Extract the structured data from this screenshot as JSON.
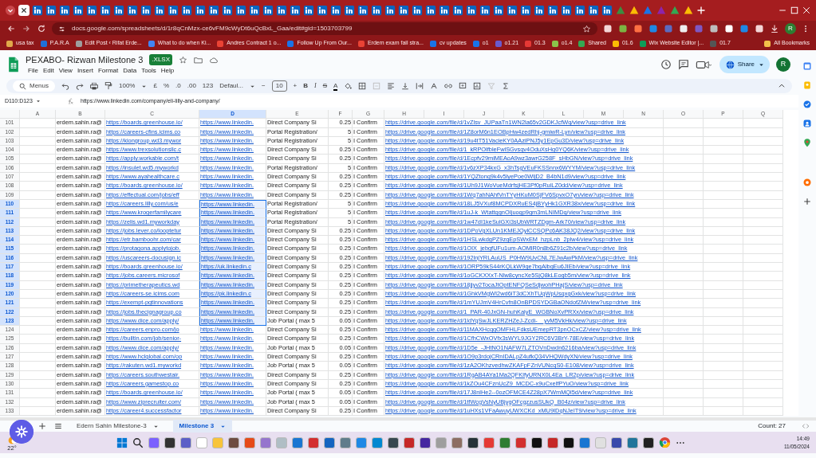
{
  "browser": {
    "url": "docs.google.com/spreadsheets/d/1r8qCnMzx-ce6vFM9cWyDt6uQcBxL_Gaa/edit#gid=1503703799",
    "profile": "R",
    "all_bookmarks": "All Bookmarks",
    "bookmarks": [
      "usa tax",
      "P.A.R.A",
      "Edit Post ‹ Rifat Erde...",
      "What to do when Ki...",
      "Andres Contract 1 o...",
      "Follow Up From Our...",
      "Erdem exam fail stra...",
      "cv updates",
      "o1",
      "o1.21",
      "01.3",
      "o1.4",
      "Shared",
      "01.6",
      "Wix Website Editor |...",
      "01.7"
    ]
  },
  "doc": {
    "title": "PEXABO- Rizwan Milestone 3",
    "badge": ".XLSX",
    "menu": [
      "File",
      "Edit",
      "View",
      "Insert",
      "Format",
      "Data",
      "Tools",
      "Help"
    ],
    "share": "Share",
    "avatar": "R"
  },
  "toolbar": {
    "search": "Menus",
    "zoom": "100%",
    "currency": "£",
    "percent": "%",
    "decrease_decimal": ".0",
    "increase_decimal": ".00",
    "number_format": "123",
    "font": "Defaul...",
    "font_size": "10",
    "minus": "−",
    "plus": "+",
    "bold": "B",
    "italic": "I",
    "strike": "S",
    "text_color": "A"
  },
  "formula_bar": {
    "name_box": "D110:D123",
    "formula": "https://www.linkedin.com/company/eli-lilly-and-company/"
  },
  "columns": [
    {
      "label": "A",
      "selected": false
    },
    {
      "label": "B",
      "kind": "text",
      "selected": false
    },
    {
      "label": "C",
      "kind": "link",
      "selected": false
    },
    {
      "label": "D",
      "kind": "link",
      "selected": true
    },
    {
      "label": "E",
      "kind": "text",
      "selected": false
    },
    {
      "label": "F",
      "kind": "number",
      "selected": false
    },
    {
      "label": "G",
      "kind": "text",
      "selected": false
    },
    {
      "label": "H",
      "kind": "link",
      "selected": false
    },
    {
      "label": "I",
      "selected": false
    },
    {
      "label": "J",
      "selected": false
    },
    {
      "label": "K",
      "selected": false
    },
    {
      "label": "L",
      "selected": false
    },
    {
      "label": "M",
      "selected": false
    },
    {
      "label": "N",
      "selected": false
    },
    {
      "label": "O",
      "selected": false
    },
    {
      "label": "P",
      "selected": false
    },
    {
      "label": "Q",
      "selected": false
    }
  ],
  "rows": [
    {
      "number": "101",
      "selected": false,
      "cells": [
        "erdem.sahin.ra@",
        "https://boards.greenhouse.io/",
        "https://www.linkedin.",
        "Direct Company Si",
        "0.25",
        "I Confirm",
        "https://drive.google.com/file/d/1vZlsv_JUPaaTn1WN2la65v2GDKJcfWq/view?usp=drive_link"
      ]
    },
    {
      "number": "102",
      "selected": false,
      "cells": [
        "erdem.sahin.ra@",
        "https://careers-cfins.icims.co",
        "https://www.linkedin.",
        "Portal Registration/",
        "5",
        "I Confirm",
        "https://drive.google.com/file/d/1Z8orM6n1EOBpHw4zedRhj-gmiwR-Lyn/view?usp=drive_link"
      ]
    },
    {
      "number": "103",
      "selected": false,
      "cells": [
        "erdem.sahin.ra@",
        "https://kiongroup.wd3.mywor",
        "https://www.linkedin.",
        "Portal Registration/",
        "5",
        "I Confirm",
        "https://drive.google.com/file/d/19u4tT51VacieKY0AAziPNJ5y1EpGu3D/view?usp=drive_link"
      ]
    },
    {
      "number": "104",
      "selected": false,
      "cells": [
        "erdem.sahin.ra@",
        "https://www.trexsolutionsllc.c",
        "https://www.linkedin.",
        "Direct Company Si",
        "0.25",
        "I Confirm",
        "https://drive.google.com/file/d/1_kRPOlfbleFwlSGvsqv4OduXsHg0YQ6K/view?usp=drive_link"
      ]
    },
    {
      "number": "105",
      "selected": false,
      "cells": [
        "erdem.sahin.ra@",
        "https://apply.workable.com/t",
        "https://www.linkedin.",
        "Direct Company Si",
        "0.25",
        "I Confirm",
        "https://drive.google.com/file/d/1Ecpfv29miMEAoA9wz3awrG258F_sHbGN/view?usp=drive_link"
      ]
    },
    {
      "number": "106",
      "selected": false,
      "cells": [
        "erdem.sahin.ra@",
        "https://insulet.wd5.myworkd",
        "https://www.linkedin.",
        "Portal Registration/",
        "5",
        "I Confirm",
        "https://drive.google.com/file/d/1v6zXP34kxG_x3hTsgVEuFKSSnnx6WYYM/view?usp=drive_link"
      ]
    },
    {
      "number": "107",
      "selected": false,
      "cells": [
        "erdem.sahin.ra@",
        "https://www.ayahealthcare.c",
        "https://www.linkedin.",
        "Direct Company Si",
        "0.25",
        "I Confirm",
        "https://drive.google.com/file/d/1YQZtonq9k4v5lyePoe0WljD2_B4bN1d9/view?usp=drive_link"
      ]
    },
    {
      "number": "108",
      "selected": false,
      "cells": [
        "erdem.sahin.ra@",
        "https://boards.greenhouse.io/",
        "https://www.linkedin.",
        "Direct Company Si",
        "0.25",
        "I Confirm",
        "https://drive.google.com/file/d/1Uh9J1WoVueMdrfsjHE3Pf0pRuiLZ0dd/view?usp=drive_link"
      ]
    },
    {
      "number": "109",
      "selected": false,
      "cells": [
        "erdem.sahin.ra@",
        "https://effectual.com/jobs/eff",
        "https://www.linkedin.",
        "Direct Company Si",
        "0.25",
        "I Confirm",
        "https://drive.google.com/file/d/1Wq7ahNAhfVnTYyHKuM0SjFV6SpvxO7yn/view?usp=drive_link"
      ]
    },
    {
      "number": "110",
      "selected": true,
      "cells": [
        "erdem.sahin.ra@",
        "https://careers.lilly.com/us/e",
        "https://www.linkedin.",
        "Portal Registration/",
        "5",
        "I Confirm",
        "https://drive.google.com/file/d/18LJ5VXuf8MCPDXRuES4jBYyHk1GXR38x/view?usp=drive_link"
      ]
    },
    {
      "number": "111",
      "selected": true,
      "cells": [
        "erdem.sahin.ra@",
        "https://www.krogerfamilycare",
        "https://www.linkedin.",
        "Portal Registration/",
        "5",
        "I Confirm",
        "https://drive.google.com/file/d/1uJ-k_WtattqgnOIjuoqp9gm3mLNIMDq/view?usp=drive_link"
      ]
    },
    {
      "number": "112",
      "selected": true,
      "cells": [
        "erdem.sahin.ra@",
        "https://zelis.wd1.myworkday",
        "https://www.linkedin.",
        "Portal Registration/",
        "5",
        "I Confirm",
        "https://drive.google.com/file/d/1w47dI1keSulGXi3sUbWRTZDgm-Ark70/view?usp=drive_link"
      ]
    },
    {
      "number": "113",
      "selected": true,
      "cells": [
        "erdem.sahin.ra@",
        "https://jobs.lever.co/looptetur",
        "https://www.linkedin.",
        "Direct Company Si",
        "0.25",
        "I Confirm",
        "https://drive.google.com/file/d/1DPoVgXLUn1KMEJQylCCSQPc6AK38JQ2/view?usp=drive_link"
      ]
    },
    {
      "number": "114",
      "selected": true,
      "cells": [
        "erdem.sahin.ra@",
        "https://etr.bamboohr.com/car",
        "https://www.linkedin.",
        "Direct Company Si",
        "0.25",
        "I Confirm",
        "https://drive.google.com/file/d/1HSLwkdgPZ9zgEpSWxEM_hzpLnb_2plw4/view?usp=drive_link"
      ]
    },
    {
      "number": "115",
      "selected": true,
      "cells": [
        "erdem.sahin.ra@",
        "https://protagona.applytojob.",
        "https://www.linkedin.",
        "Direct Company Si",
        "0.25",
        "I Confirm",
        "https://drive.google.com/file/d/1OIX_jebgfUFu1um-AOMlR0n8b6Z91c2b/view?usp=drive_link"
      ]
    },
    {
      "number": "116",
      "selected": true,
      "cells": [
        "erdem.sahin.ra@",
        "https://uscareers-docusign.ic",
        "https://www.linkedin.",
        "Direct Company Si",
        "0.25",
        "I Confirm",
        "https://drive.google.com/file/d/192lnjYRLAuUS_P0HW9UvCNL7EJwAwPkM/view?usp=drive_link"
      ]
    },
    {
      "number": "117",
      "selected": true,
      "cells": [
        "erdem.sahin.ra@",
        "https://boards.greenhouse.io/",
        "https://uk.linkedin.c",
        "Direct Company Si",
        "0.25",
        "I Confirm",
        "https://drive.google.com/file/d/1ORP59kS44rKQLkW9ge7bgAlbgEu6JIEb/view?usp=drive_link"
      ]
    },
    {
      "number": "118",
      "selected": true,
      "cells": [
        "erdem.sahin.ra@",
        "https://jobs.careers.microsof",
        "https://www.linkedin.",
        "Direct Company Si",
        "0.25",
        "I Confirm",
        "https://drive.google.com/file/d/1oGCKXXxT-Nlw8cyncXe5SjQ8kLEogb5m/view?usp=drive_link"
      ]
    },
    {
      "number": "119",
      "selected": true,
      "cells": [
        "erdem.sahin.ra@",
        "https://primetherapeutics.wd",
        "https://www.linkedin.",
        "Direct Company Si",
        "0.25",
        "I Confirm",
        "https://drive.google.com/file/d/18jjyv2TocaJtOptENFQSeSdjwohPHajS/view?usp=drive_link"
      ]
    },
    {
      "number": "120",
      "selected": true,
      "cells": [
        "erdem.sahin.ra@",
        "https://careers-se.icims.com",
        "https://pk.linkedin.c",
        "Direct Company Si",
        "0.25",
        "I Confirm",
        "https://drive.google.com/file/d/1GhkVMgWI2wd6iT3dCXhTUqWpUsqxgGxk/view?usp=drive_link"
      ]
    },
    {
      "number": "121",
      "selected": true,
      "cells": [
        "erdem.sahin.ra@",
        "https://exempt-pgtinnovations",
        "https://www.linkedin.",
        "Direct Company Si",
        "0.25",
        "I Confirm",
        "https://drive.google.com/file/d/1mYUJmV4HrCvfn8OnBPDSYDGBaONdofZM/view?usp=drive_link"
      ]
    },
    {
      "number": "122",
      "selected": true,
      "cells": [
        "erdem.sahin.ra@",
        "https://jobs.thecignagroup.co",
        "https://www.linkedin.",
        "Direct Company Si",
        "0.25",
        "I Confirm",
        "https://drive.google.com/file/d/1_PAR-40JxGN-huhKalyE_WGBNoXvPRXx/view?usp=drive_link"
      ]
    },
    {
      "number": "123",
      "selected": true,
      "cells": [
        "erdem.sahin.ra@",
        "https://www.dice.com/apply/",
        "https://www.linkedin.",
        "Job Portal ( max 5",
        "0.05",
        "I Confirm",
        "https://drive.google.com/file/d/1ldYqSwJLKERZHZeJ-Zcdi-__yvM5VkHk/view?usp=drive_link"
      ]
    },
    {
      "number": "124",
      "selected": false,
      "cells": [
        "erdem.sahin.ra@",
        "https://careers.enpro.com/jo",
        "https://www.linkedin.",
        "Direct Company Si",
        "0.25",
        "I Confirm",
        "https://drive.google.com/file/d/11MAXHcqgOMFHLFdksUEmepRT3pnOCxCZ/view?usp=drive_link"
      ]
    },
    {
      "number": "125",
      "selected": false,
      "cells": [
        "erdem.sahin.ra@",
        "https://builtin.com/job/senior-",
        "https://www.linkedin.",
        "Direct Company Si",
        "0.25",
        "I Confirm",
        "https://drive.google.com/file/d/1CfhCWxOVfx3sWYL9JGY2RC6V3BrY-78E/view?usp=drive_link"
      ]
    },
    {
      "number": "126",
      "selected": false,
      "cells": [
        "erdem.sahin.ra@",
        "https://www.dice.com/apply/",
        "https://www.linkedin.",
        "Job Portal ( max 5",
        "0.05",
        "I Confirm",
        "https://drive.google.com/file/d/1D5e_-JHtNO1NAFW7LZTOVnDwdn6216ba/view?usp=drive_link"
      ]
    },
    {
      "number": "127",
      "selected": false,
      "cells": [
        "erdem.sahin.ra@",
        "https://www.hclglobal.com/op",
        "https://www.linkedin.",
        "Direct Company Si",
        "0.25",
        "I Confirm",
        "https://drive.google.com/file/d/1O9p3rdojCRnIDALpZ4ufkQ34VHQWdyXN/view?usp=drive_link"
      ]
    },
    {
      "number": "128",
      "selected": false,
      "cells": [
        "erdem.sahin.ra@",
        "https://rakuten.wd1.myworkd",
        "https://www.linkedin.",
        "Job Portal ( max 5",
        "0.05",
        "I Confirm",
        "https://drive.google.com/file/d/1zA2OKhzvedhwZKAFpFZnVUNcqS0-E108/view?usp=drive_link"
      ]
    },
    {
      "number": "129",
      "selected": false,
      "cells": [
        "erdem.sahin.ra@",
        "https://careers.southwestair.",
        "https://www.linkedin.",
        "Direct Company Si",
        "0.25",
        "I Confirm",
        "https://drive.google.com/file/d/1RgAB4AYa1Ma2QFKlfyURNX0L4Ea_LR2p/view?usp=drive_link"
      ]
    },
    {
      "number": "130",
      "selected": false,
      "cells": [
        "erdem.sahin.ra@",
        "https://careers.gamestop.co",
        "https://www.linkedin.",
        "Direct Company Si",
        "0.25",
        "I Confirm",
        "https://drive.google.com/file/d/1kZOu4CFznUcZ9_MCDC-x9uCxelfPYuO/view?usp=drive_link"
      ]
    },
    {
      "number": "131",
      "selected": false,
      "cells": [
        "erdem.sahin.ra@",
        "https://boards.greenhouse.io/",
        "https://www.linkedin.",
        "Job Portal ( max 5",
        "0.05",
        "I Confirm",
        "https://drive.google.com/file/d/17J8nlHe2--0ozOFMCE4Z28pX7WmMQl5d/view?usp=drive_link"
      ]
    },
    {
      "number": "132",
      "selected": false,
      "cells": [
        "erdem.sahin.ra@",
        "https://www.ziprecruiter.com/",
        "https://www.linkedin.",
        "Job Portal ( max 5",
        "0.05",
        "I Confirm",
        "https://drive.google.com/file/d/1tfWcgVsNyUBjygOFcgzzusSUkQ_B04z/view?usp=drive_link"
      ]
    },
    {
      "number": "133",
      "selected": false,
      "cells": [
        "erdem.sahin.ra@",
        "https://career4.successfactor",
        "https://www.linkedin.",
        "Direct Company Si",
        "0.25",
        "I Confirm",
        "https://drive.google.com/file/d/1uHXs1VFaAwuyUWXCKd_xMU9IDqNJeIT9/view?usp=drive_link"
      ]
    }
  ],
  "sheets": [
    {
      "label": "Edern Sahin Milestone-3",
      "selected": false
    },
    {
      "label": "Milestone 3",
      "selected": true
    }
  ],
  "status": {
    "count": "Count: 27"
  },
  "taskbar": {
    "temperature": "22°",
    "time": "14:49",
    "date": "11/05/2024"
  }
}
